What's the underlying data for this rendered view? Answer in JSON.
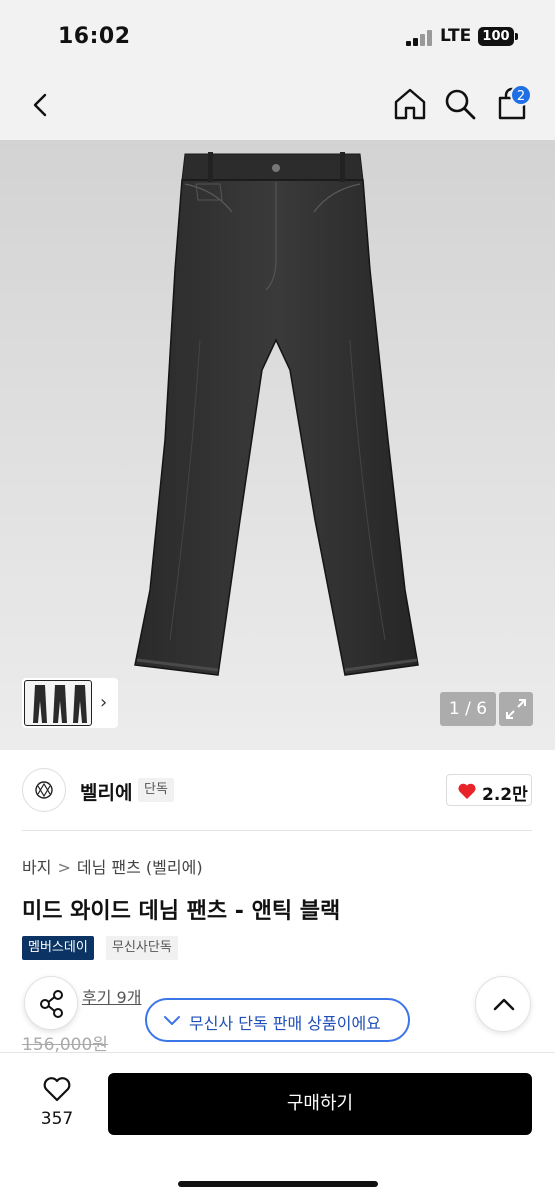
{
  "status_bar": {
    "time": "16:02",
    "network": "LTE",
    "battery": "100"
  },
  "nav": {
    "cart_count": "2"
  },
  "gallery": {
    "page_indicator": "1 / 6"
  },
  "brand": {
    "name": "벨리에",
    "tag": "단독",
    "likes": "2.2만"
  },
  "breadcrumb": {
    "level1": "바지",
    "separator": ">",
    "level2": "데님 팬츠 (벨리에)"
  },
  "product": {
    "title": "미드 와이드 데님 팬츠 - 앤틱 블랙",
    "badge_primary": "멤버스데이",
    "badge_secondary": "무신사단독",
    "reviews": "후기 9개",
    "original_price": "156,000원",
    "exclusive_notice": "무신사 단독 판매 상품이에요"
  },
  "bottom": {
    "wish_count": "357",
    "buy_label": "구매하기"
  },
  "colors": {
    "accent_blue": "#1f6fe5",
    "badge_navy": "#0b3363",
    "like_red": "#e8232a"
  }
}
